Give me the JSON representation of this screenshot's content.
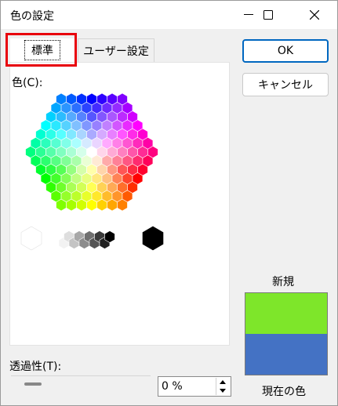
{
  "window": {
    "title": "色の設定"
  },
  "tabs": {
    "standard": "標準",
    "custom": "ユーザー設定"
  },
  "color_label": "色(C):",
  "buttons": {
    "ok": "OK",
    "cancel": "キャンセル"
  },
  "preview": {
    "new_label": "新規",
    "current_label": "現在の色",
    "new_color": "#7ee62a",
    "current_color": "#4472c4"
  },
  "transparency": {
    "label": "透過性(T):",
    "value": "0 %",
    "percent": 0
  },
  "accent": {
    "highlight": "#e8000b",
    "focus": "#0067c0"
  }
}
